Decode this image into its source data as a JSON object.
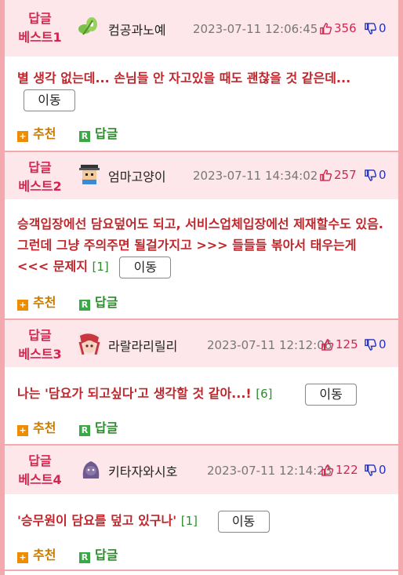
{
  "best": [
    {
      "label_line1": "답글",
      "label_line2": "베스트1",
      "avatar_icon": "sprout-avatar-icon",
      "nickname": "컴공과노예",
      "date": "2023-07-11 12:06:45",
      "upvotes": "356",
      "downvotes": "0",
      "text": "별 생각 없는데... 손님들 안 자고있을 때도 괜찮을 것 같은데...",
      "count": "",
      "move": "이동",
      "recommend": "추천",
      "reply": "답글"
    },
    {
      "label_line1": "답글",
      "label_line2": "베스트2",
      "avatar_icon": "pixel-character-avatar-icon",
      "nickname": "엄마고양이",
      "date": "2023-07-11 14:34:02",
      "upvotes": "257",
      "downvotes": "0",
      "text": "승객입장에선 담요덮어도 되고, 서비스업체입장에선 제재할수도 있음. 그런데 그냥 주의주면 될걸가지고 >>> 들들들 볶아서 태우는게 <<< 문제지",
      "count": "[1]",
      "move": "이동",
      "recommend": "추천",
      "reply": "답글"
    },
    {
      "label_line1": "답글",
      "label_line2": "베스트3",
      "avatar_icon": "anime-character-avatar-icon",
      "nickname": "라랄라리릴리",
      "date": "2023-07-11 12:12:06",
      "upvotes": "125",
      "downvotes": "0",
      "text": "나는 '담요가 되고싶다'고 생각할 것 같아...!",
      "count": "[6]",
      "move": "이동",
      "recommend": "추천",
      "reply": "답글"
    },
    {
      "label_line1": "답글",
      "label_line2": "베스트4",
      "avatar_icon": "purple-hooded-avatar-icon",
      "nickname": "키타자와시호",
      "date": "2023-07-11 12:14:23",
      "upvotes": "122",
      "downvotes": "0",
      "text": "'승무원이 담요를 덮고 있구나'",
      "count": "[1]",
      "move": "이동",
      "recommend": "추천",
      "reply": "답글"
    }
  ],
  "colors": {
    "accent": "#d6244e",
    "border": "#f4a9ae",
    "header_bg": "#fde7ea",
    "body_text": "#c0262b"
  }
}
